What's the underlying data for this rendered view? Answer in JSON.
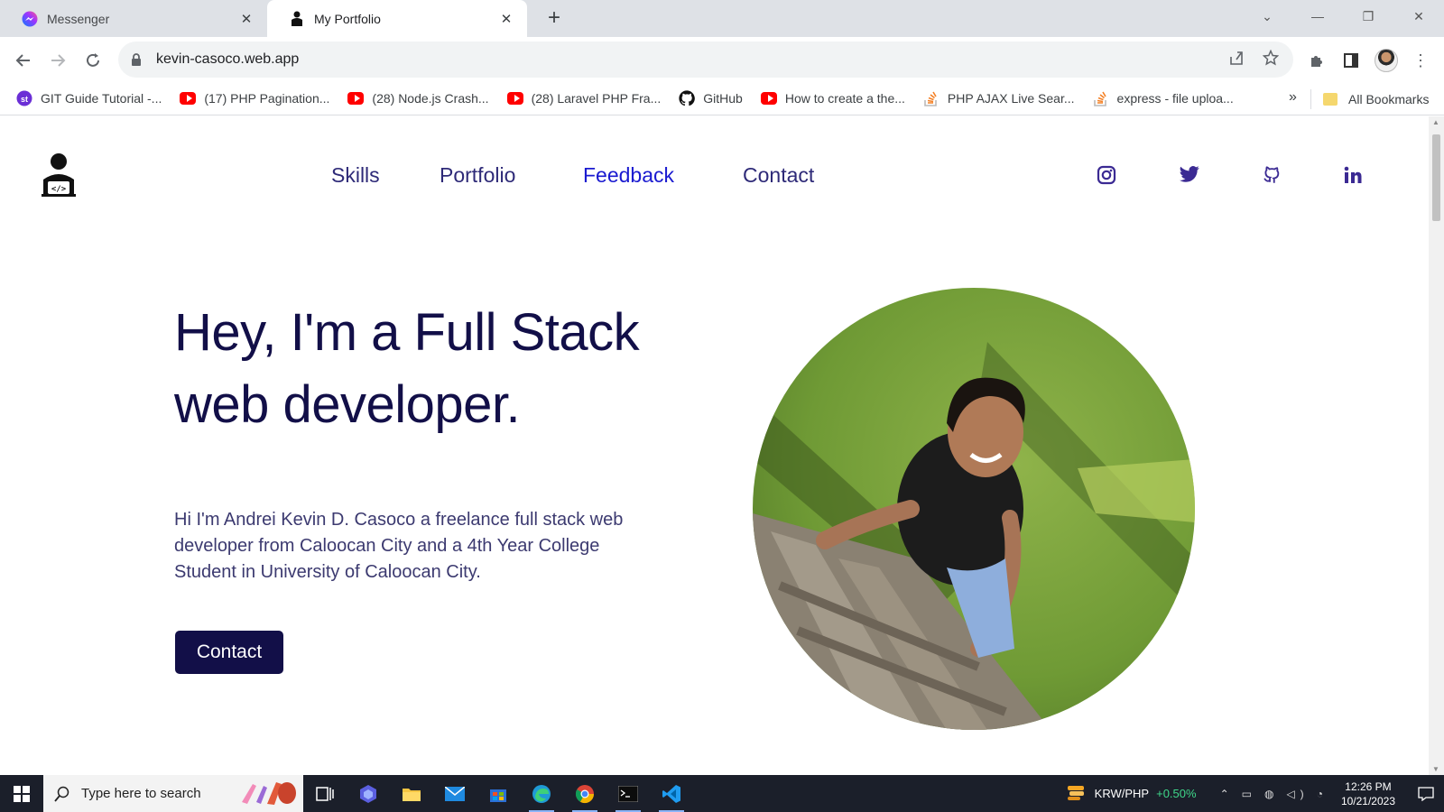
{
  "browser": {
    "tabs": [
      {
        "title": "Messenger",
        "icon": "messenger-icon",
        "active": false
      },
      {
        "title": "My Portfolio",
        "icon": "coder-icon",
        "active": true
      }
    ],
    "url": "kevin-casoco.web.app",
    "bookmarks": [
      {
        "label": "GIT Guide Tutorial -...",
        "icon": "st-icon"
      },
      {
        "label": "(17) PHP Pagination...",
        "icon": "youtube-icon"
      },
      {
        "label": "(28) Node.js Crash...",
        "icon": "youtube-icon"
      },
      {
        "label": "(28) Laravel PHP Fra...",
        "icon": "youtube-icon"
      },
      {
        "label": "GitHub",
        "icon": "github-icon"
      },
      {
        "label": "How to create a the...",
        "icon": "youtube-icon"
      },
      {
        "label": "PHP AJAX Live Sear...",
        "icon": "stackoverflow-icon"
      },
      {
        "label": "express - file uploa...",
        "icon": "stackoverflow-icon"
      }
    ],
    "more_bookmarks": "»",
    "all_bookmarks": "All Bookmarks"
  },
  "page": {
    "nav": [
      {
        "label": "Skills",
        "active": false
      },
      {
        "label": "Portfolio",
        "active": false
      },
      {
        "label": "Feedback",
        "active": true
      },
      {
        "label": "Contact",
        "active": false
      }
    ],
    "social": [
      "instagram-icon",
      "twitter-icon",
      "github-icon",
      "linkedin-icon"
    ],
    "hero_title_line1": "Hey, I'm a Full Stack",
    "hero_title_line2": "web developer.",
    "hero_text": "Hi I'm Andrei Kevin D. Casoco a freelance full stack web developer from Caloocan City and a 4th Year College Student in University of Caloocan City.",
    "cta_label": "Contact",
    "colors": {
      "primary": "#120f48",
      "nav": "#2e2a78",
      "nav_active": "#1a1ad0",
      "social": "#3b2a93"
    }
  },
  "taskbar": {
    "search_placeholder": "Type here to search",
    "currency_pair": "KRW/PHP",
    "currency_change": "+0.50%",
    "time": "12:26 PM",
    "date": "10/21/2023",
    "apps": [
      "task-view-icon",
      "copilot-icon",
      "file-explorer-icon",
      "mail-icon",
      "store-icon",
      "edge-icon",
      "chrome-icon",
      "terminal-icon",
      "vscode-icon"
    ]
  }
}
